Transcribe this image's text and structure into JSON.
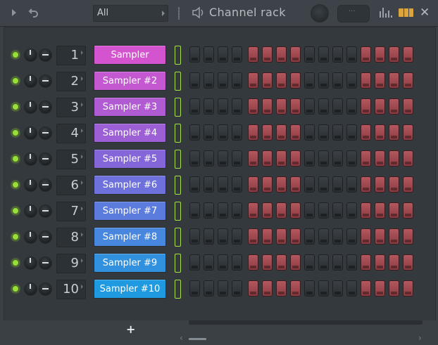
{
  "header": {
    "filter_value": "All",
    "title": "Channel rack",
    "swing_placeholder": "···"
  },
  "channels": [
    {
      "number": "1",
      "name": "Sampler",
      "color": "#d454cf",
      "steps": [
        0,
        0,
        0,
        0,
        1,
        1,
        1,
        1,
        0,
        0,
        0,
        0,
        1,
        1,
        1,
        1
      ]
    },
    {
      "number": "2",
      "name": "Sampler #2",
      "color": "#c358d1",
      "steps": [
        0,
        0,
        0,
        0,
        1,
        1,
        1,
        1,
        0,
        0,
        0,
        0,
        1,
        1,
        1,
        1
      ]
    },
    {
      "number": "3",
      "name": "Sampler #3",
      "color": "#b15bd3",
      "steps": [
        0,
        0,
        0,
        0,
        1,
        1,
        1,
        1,
        0,
        0,
        0,
        0,
        1,
        1,
        1,
        1
      ]
    },
    {
      "number": "4",
      "name": "Sampler #4",
      "color": "#9d5fd6",
      "steps": [
        0,
        0,
        0,
        0,
        1,
        1,
        1,
        1,
        0,
        0,
        0,
        0,
        1,
        1,
        1,
        1
      ]
    },
    {
      "number": "5",
      "name": "Sampler #5",
      "color": "#8566d8",
      "steps": [
        0,
        0,
        0,
        0,
        1,
        1,
        1,
        1,
        0,
        0,
        0,
        0,
        1,
        1,
        1,
        1
      ]
    },
    {
      "number": "6",
      "name": "Sampler #6",
      "color": "#6e70db",
      "steps": [
        0,
        0,
        0,
        0,
        1,
        1,
        1,
        1,
        0,
        0,
        0,
        0,
        1,
        1,
        1,
        1
      ]
    },
    {
      "number": "7",
      "name": "Sampler #7",
      "color": "#5b7cdd",
      "steps": [
        0,
        0,
        0,
        0,
        1,
        1,
        1,
        1,
        0,
        0,
        0,
        0,
        1,
        1,
        1,
        1
      ]
    },
    {
      "number": "8",
      "name": "Sampler #8",
      "color": "#4787de",
      "steps": [
        0,
        0,
        0,
        0,
        1,
        1,
        1,
        1,
        0,
        0,
        0,
        0,
        1,
        1,
        1,
        1
      ]
    },
    {
      "number": "9",
      "name": "Sampler #9",
      "color": "#3191de",
      "steps": [
        0,
        0,
        0,
        0,
        1,
        1,
        1,
        1,
        0,
        0,
        0,
        0,
        1,
        1,
        1,
        1
      ]
    },
    {
      "number": "10",
      "name": "Sampler #10",
      "color": "#1f9ae0",
      "steps": [
        0,
        0,
        0,
        0,
        1,
        1,
        1,
        1,
        0,
        0,
        0,
        0,
        1,
        1,
        1,
        1
      ]
    }
  ],
  "footer": {
    "add_label": "+",
    "scroll_left": "‹",
    "scroll_right": "›"
  },
  "icons": {
    "play": "play-icon",
    "undo": "undo-icon",
    "speaker": "speaker-icon",
    "graph": "graph-editor-icon",
    "piano": "piano-roll-icon",
    "close": "close-icon"
  }
}
